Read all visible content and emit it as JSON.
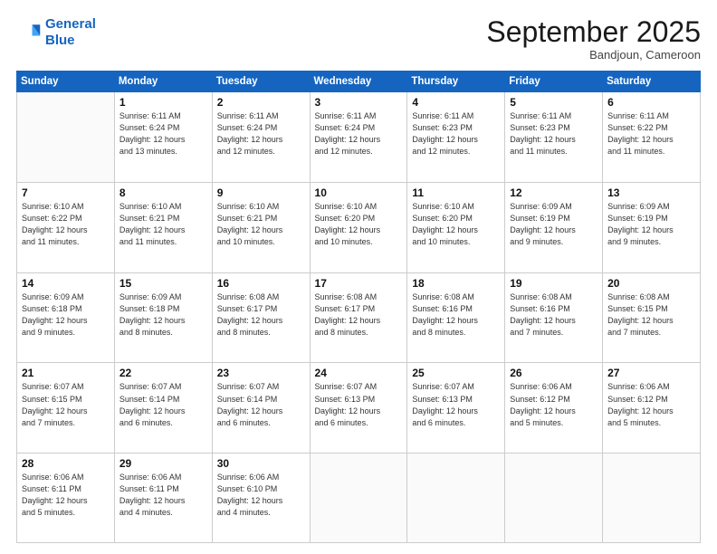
{
  "header": {
    "logo_line1": "General",
    "logo_line2": "Blue",
    "month": "September 2025",
    "location": "Bandjoun, Cameroon"
  },
  "weekdays": [
    "Sunday",
    "Monday",
    "Tuesday",
    "Wednesday",
    "Thursday",
    "Friday",
    "Saturday"
  ],
  "weeks": [
    [
      {
        "day": "",
        "info": ""
      },
      {
        "day": "1",
        "info": "Sunrise: 6:11 AM\nSunset: 6:24 PM\nDaylight: 12 hours\nand 13 minutes."
      },
      {
        "day": "2",
        "info": "Sunrise: 6:11 AM\nSunset: 6:24 PM\nDaylight: 12 hours\nand 12 minutes."
      },
      {
        "day": "3",
        "info": "Sunrise: 6:11 AM\nSunset: 6:24 PM\nDaylight: 12 hours\nand 12 minutes."
      },
      {
        "day": "4",
        "info": "Sunrise: 6:11 AM\nSunset: 6:23 PM\nDaylight: 12 hours\nand 12 minutes."
      },
      {
        "day": "5",
        "info": "Sunrise: 6:11 AM\nSunset: 6:23 PM\nDaylight: 12 hours\nand 11 minutes."
      },
      {
        "day": "6",
        "info": "Sunrise: 6:11 AM\nSunset: 6:22 PM\nDaylight: 12 hours\nand 11 minutes."
      }
    ],
    [
      {
        "day": "7",
        "info": "Sunrise: 6:10 AM\nSunset: 6:22 PM\nDaylight: 12 hours\nand 11 minutes."
      },
      {
        "day": "8",
        "info": "Sunrise: 6:10 AM\nSunset: 6:21 PM\nDaylight: 12 hours\nand 11 minutes."
      },
      {
        "day": "9",
        "info": "Sunrise: 6:10 AM\nSunset: 6:21 PM\nDaylight: 12 hours\nand 10 minutes."
      },
      {
        "day": "10",
        "info": "Sunrise: 6:10 AM\nSunset: 6:20 PM\nDaylight: 12 hours\nand 10 minutes."
      },
      {
        "day": "11",
        "info": "Sunrise: 6:10 AM\nSunset: 6:20 PM\nDaylight: 12 hours\nand 10 minutes."
      },
      {
        "day": "12",
        "info": "Sunrise: 6:09 AM\nSunset: 6:19 PM\nDaylight: 12 hours\nand 9 minutes."
      },
      {
        "day": "13",
        "info": "Sunrise: 6:09 AM\nSunset: 6:19 PM\nDaylight: 12 hours\nand 9 minutes."
      }
    ],
    [
      {
        "day": "14",
        "info": "Sunrise: 6:09 AM\nSunset: 6:18 PM\nDaylight: 12 hours\nand 9 minutes."
      },
      {
        "day": "15",
        "info": "Sunrise: 6:09 AM\nSunset: 6:18 PM\nDaylight: 12 hours\nand 8 minutes."
      },
      {
        "day": "16",
        "info": "Sunrise: 6:08 AM\nSunset: 6:17 PM\nDaylight: 12 hours\nand 8 minutes."
      },
      {
        "day": "17",
        "info": "Sunrise: 6:08 AM\nSunset: 6:17 PM\nDaylight: 12 hours\nand 8 minutes."
      },
      {
        "day": "18",
        "info": "Sunrise: 6:08 AM\nSunset: 6:16 PM\nDaylight: 12 hours\nand 8 minutes."
      },
      {
        "day": "19",
        "info": "Sunrise: 6:08 AM\nSunset: 6:16 PM\nDaylight: 12 hours\nand 7 minutes."
      },
      {
        "day": "20",
        "info": "Sunrise: 6:08 AM\nSunset: 6:15 PM\nDaylight: 12 hours\nand 7 minutes."
      }
    ],
    [
      {
        "day": "21",
        "info": "Sunrise: 6:07 AM\nSunset: 6:15 PM\nDaylight: 12 hours\nand 7 minutes."
      },
      {
        "day": "22",
        "info": "Sunrise: 6:07 AM\nSunset: 6:14 PM\nDaylight: 12 hours\nand 6 minutes."
      },
      {
        "day": "23",
        "info": "Sunrise: 6:07 AM\nSunset: 6:14 PM\nDaylight: 12 hours\nand 6 minutes."
      },
      {
        "day": "24",
        "info": "Sunrise: 6:07 AM\nSunset: 6:13 PM\nDaylight: 12 hours\nand 6 minutes."
      },
      {
        "day": "25",
        "info": "Sunrise: 6:07 AM\nSunset: 6:13 PM\nDaylight: 12 hours\nand 6 minutes."
      },
      {
        "day": "26",
        "info": "Sunrise: 6:06 AM\nSunset: 6:12 PM\nDaylight: 12 hours\nand 5 minutes."
      },
      {
        "day": "27",
        "info": "Sunrise: 6:06 AM\nSunset: 6:12 PM\nDaylight: 12 hours\nand 5 minutes."
      }
    ],
    [
      {
        "day": "28",
        "info": "Sunrise: 6:06 AM\nSunset: 6:11 PM\nDaylight: 12 hours\nand 5 minutes."
      },
      {
        "day": "29",
        "info": "Sunrise: 6:06 AM\nSunset: 6:11 PM\nDaylight: 12 hours\nand 4 minutes."
      },
      {
        "day": "30",
        "info": "Sunrise: 6:06 AM\nSunset: 6:10 PM\nDaylight: 12 hours\nand 4 minutes."
      },
      {
        "day": "",
        "info": ""
      },
      {
        "day": "",
        "info": ""
      },
      {
        "day": "",
        "info": ""
      },
      {
        "day": "",
        "info": ""
      }
    ]
  ]
}
